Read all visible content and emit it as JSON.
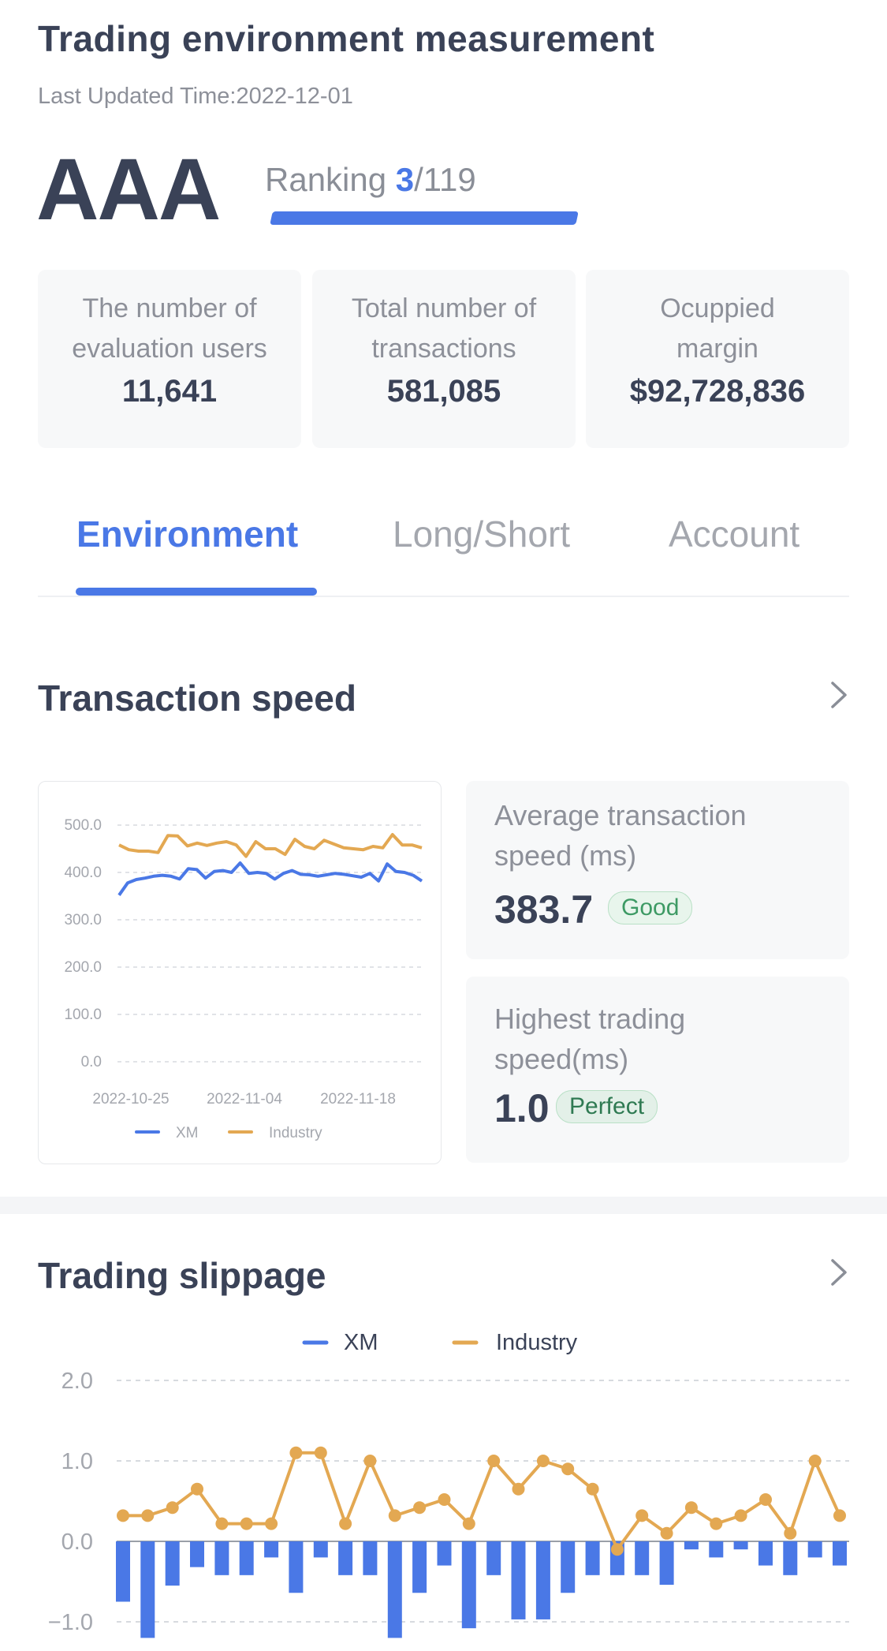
{
  "header": {
    "title": "Trading environment measurement",
    "updated_label": "Last Updated Time:",
    "updated_value": "2022-12-01",
    "rating": "AAA",
    "ranking_label": "Ranking",
    "ranking_position": "3",
    "ranking_total": "/119",
    "ranking_fraction": 0.975
  },
  "cards": [
    {
      "label_line1": "The number of",
      "label_line2": "evaluation users",
      "value": "11,641"
    },
    {
      "label_line1": "Total number of",
      "label_line2": "transactions",
      "value": "581,085"
    },
    {
      "label_line1": "Ocuppied",
      "label_line2": "margin",
      "value": "$92,728,836"
    }
  ],
  "tabs": [
    {
      "label": "Environment",
      "active": true
    },
    {
      "label": "Long/Short",
      "active": false
    },
    {
      "label": "Account",
      "active": false
    }
  ],
  "speed": {
    "title": "Transaction speed",
    "avg": {
      "label_line1": "Average transaction",
      "label_line2": "speed (ms)",
      "value": "383.7",
      "badge": "Good"
    },
    "max": {
      "label_line1": "Highest trading",
      "label_line2": "speed(ms)",
      "value": "1.0",
      "badge": "Perfect"
    }
  },
  "slippage": {
    "title": "Trading slippage"
  },
  "colors": {
    "xm": "#4a78e6",
    "industry": "#e3a852",
    "accent": "#4a78e6"
  },
  "chart_data": [
    {
      "type": "line",
      "ylim": [
        0,
        500
      ],
      "yticks": [
        "500.0",
        "400.0",
        "300.0",
        "200.0",
        "100.0",
        "0.0"
      ],
      "xticks": [
        "2022-10-25",
        "2022-11-04",
        "2022-11-18"
      ],
      "grid": true,
      "legend": "bottom",
      "series": [
        {
          "name": "XM",
          "values": [
            352,
            378,
            385,
            388,
            392,
            394,
            392,
            386,
            408,
            406,
            388,
            402,
            404,
            400,
            420,
            398,
            400,
            398,
            386,
            398,
            404,
            396,
            395,
            392,
            395,
            398,
            396,
            393,
            390,
            398,
            382,
            418,
            402,
            400,
            394,
            382
          ]
        },
        {
          "name": "Industry",
          "values": [
            458,
            448,
            445,
            445,
            442,
            478,
            477,
            456,
            462,
            457,
            462,
            465,
            458,
            434,
            465,
            450,
            450,
            438,
            470,
            455,
            450,
            468,
            460,
            452,
            450,
            448,
            455,
            452,
            480,
            458,
            458,
            452
          ]
        }
      ]
    },
    {
      "type": "bar",
      "ylim": [
        -1.2,
        2.2
      ],
      "yticks": [
        "2.0",
        "1.0",
        "0.0",
        "-1.0"
      ],
      "grid": true,
      "legend": "top",
      "series": [
        {
          "name": "XM",
          "values": [
            -0.75,
            -1.2,
            -0.55,
            -0.32,
            -0.42,
            -0.42,
            -0.2,
            -0.64,
            -0.2,
            -0.42,
            -0.42,
            -1.2,
            -0.64,
            -0.3,
            -1.08,
            -0.42,
            -0.97,
            -0.97,
            -0.64,
            -0.42,
            -0.42,
            -0.42,
            -0.54,
            -0.1,
            -0.2,
            -0.1,
            -0.3,
            -0.42,
            -0.2,
            -0.3
          ]
        },
        {
          "name": "Industry",
          "values": [
            0.32,
            0.32,
            0.42,
            0.65,
            0.22,
            0.22,
            0.22,
            1.1,
            1.1,
            0.22,
            1.0,
            0.32,
            0.42,
            0.52,
            0.22,
            1.0,
            0.65,
            1.0,
            0.9,
            0.65,
            -0.1,
            0.32,
            0.1,
            0.42,
            0.22,
            0.32,
            0.52,
            0.1,
            1.0,
            0.32
          ]
        }
      ]
    }
  ]
}
